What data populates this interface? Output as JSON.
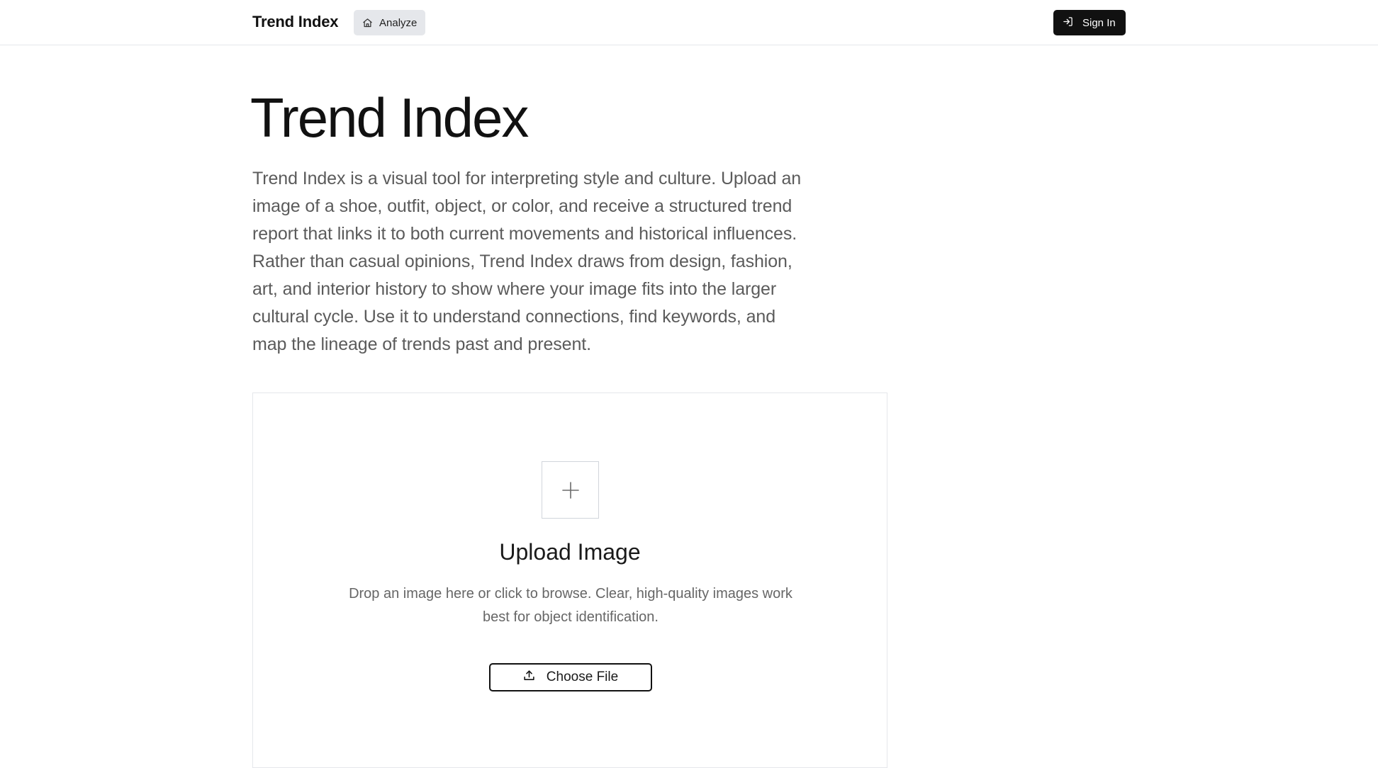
{
  "header": {
    "brand": "Trend Index",
    "nav": {
      "analyze_label": "Analyze",
      "analyze_icon": "home-icon"
    },
    "signin": {
      "label": "Sign In",
      "icon": "sign-in-icon"
    }
  },
  "hero": {
    "title": "Trend Index",
    "description": "Trend Index is a visual tool for interpreting style and culture. Upload an image of a shoe, outfit, object, or color, and receive a structured trend report that links it to both current movements and historical influences. Rather than casual opinions, Trend Index draws from design, fashion, art, and interior history to show where your image fits into the larger cultural cycle. Use it to understand connections, find keywords, and map the lineage of trends past and present."
  },
  "upload": {
    "icon": "plus-icon",
    "title": "Upload Image",
    "hint": "Drop an image here or click to browse. Clear, high-quality images work best for object identification.",
    "button_label": "Choose File",
    "button_icon": "upload-icon"
  },
  "colors": {
    "primary": "#111111",
    "nav_bg": "#e5e7eb",
    "border": "#e5e7eb",
    "muted_text": "#5b5b5b"
  }
}
